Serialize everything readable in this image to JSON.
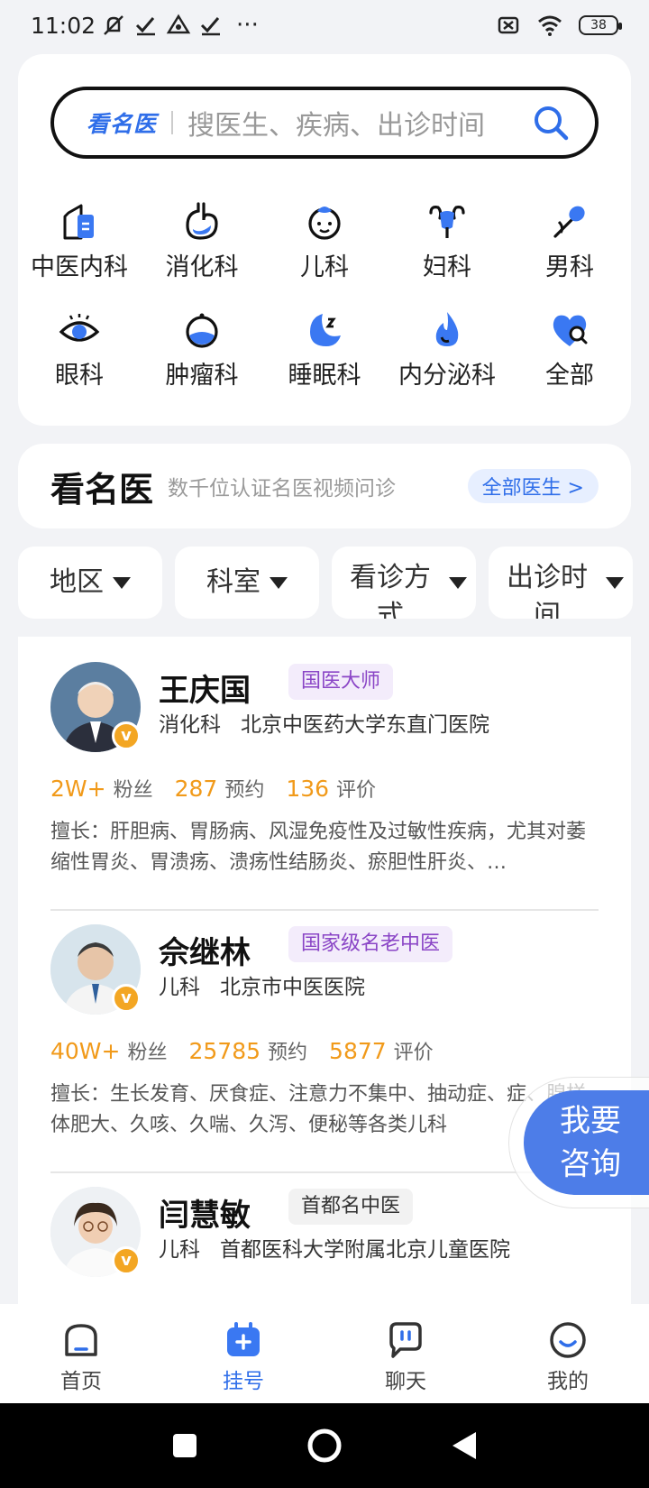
{
  "status": {
    "time": "11:02",
    "dots": "···",
    "battery": "38"
  },
  "search": {
    "brand": "看名医",
    "placeholder": "搜医生、疾病、出诊时间"
  },
  "categories": [
    {
      "label": "中医内科",
      "icon": "tcm-clipboard-icon"
    },
    {
      "label": "消化科",
      "icon": "stomach-icon"
    },
    {
      "label": "儿科",
      "icon": "baby-icon"
    },
    {
      "label": "妇科",
      "icon": "uterus-icon"
    },
    {
      "label": "男科",
      "icon": "male-icon"
    },
    {
      "label": "眼科",
      "icon": "eye-icon"
    },
    {
      "label": "肿瘤科",
      "icon": "tumor-icon"
    },
    {
      "label": "睡眠科",
      "icon": "moon-icon"
    },
    {
      "label": "内分泌科",
      "icon": "flame-icon"
    },
    {
      "label": "全部",
      "icon": "heart-search-icon"
    }
  ],
  "famous": {
    "title": "看名医",
    "subtitle": "数千位认证名医视频问诊",
    "all_label": "全部医生 >"
  },
  "filters": [
    "地区",
    "科室",
    "看诊方式",
    "出诊时间"
  ],
  "doctors": [
    {
      "name": "王庆国",
      "tag": "国医大师",
      "dept": "消化科",
      "hospital": "北京中医药大学东直门医院",
      "fans": "2W+",
      "fans_label": "粉丝",
      "appoint": "287",
      "appoint_label": "预约",
      "reviews": "136",
      "reviews_label": "评价",
      "skill": "擅长：肝胆病、胃肠病、风湿免疫性及过敏性疾病，尤其对萎缩性胃炎、胃溃疡、溃疡性结肠炎、瘀胆性肝炎、…"
    },
    {
      "name": "佘继林",
      "tag": "国家级名老中医",
      "dept": "儿科",
      "hospital": "北京市中医医院",
      "fans": "40W+",
      "fans_label": "粉丝",
      "appoint": "25785",
      "appoint_label": "预约",
      "reviews": "5877",
      "reviews_label": "评价",
      "skill": "擅长：生长发育、厌食症、注意力不集中、抽动症、症、腺样体肥大、久咳、久喘、久泻、便秘等各类儿科"
    },
    {
      "name": "闫慧敏",
      "tag": "首都名中医",
      "dept": "儿科",
      "hospital": "首都医科大学附属北京儿童医院"
    }
  ],
  "consult": {
    "line1": "我要",
    "line2": "咨询"
  },
  "bottom_nav": [
    {
      "label": "首页",
      "icon": "home-icon"
    },
    {
      "label": "挂号",
      "icon": "register-plus-icon"
    },
    {
      "label": "聊天",
      "icon": "chat-icon"
    },
    {
      "label": "我的",
      "icon": "profile-icon"
    }
  ],
  "colors": {
    "accent": "#2f6ee9",
    "orange": "#f19a1a",
    "purple": "#8a45c6",
    "consult": "#4d7de8"
  }
}
